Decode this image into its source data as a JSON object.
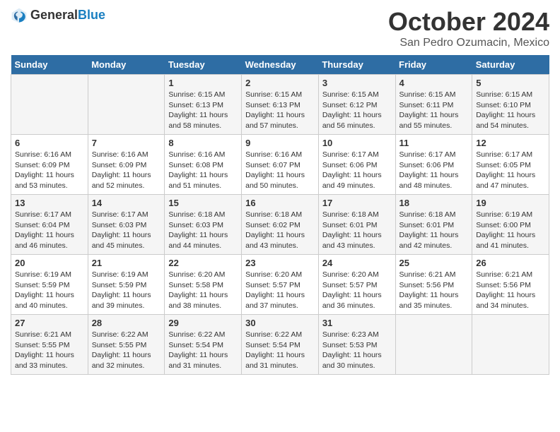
{
  "logo": {
    "general": "General",
    "blue": "Blue"
  },
  "title": "October 2024",
  "location": "San Pedro Ozumacin, Mexico",
  "days_header": [
    "Sunday",
    "Monday",
    "Tuesday",
    "Wednesday",
    "Thursday",
    "Friday",
    "Saturday"
  ],
  "weeks": [
    [
      {
        "day": "",
        "info": ""
      },
      {
        "day": "",
        "info": ""
      },
      {
        "day": "1",
        "info": "Sunrise: 6:15 AM\nSunset: 6:13 PM\nDaylight: 11 hours and 58 minutes."
      },
      {
        "day": "2",
        "info": "Sunrise: 6:15 AM\nSunset: 6:13 PM\nDaylight: 11 hours and 57 minutes."
      },
      {
        "day": "3",
        "info": "Sunrise: 6:15 AM\nSunset: 6:12 PM\nDaylight: 11 hours and 56 minutes."
      },
      {
        "day": "4",
        "info": "Sunrise: 6:15 AM\nSunset: 6:11 PM\nDaylight: 11 hours and 55 minutes."
      },
      {
        "day": "5",
        "info": "Sunrise: 6:15 AM\nSunset: 6:10 PM\nDaylight: 11 hours and 54 minutes."
      }
    ],
    [
      {
        "day": "6",
        "info": "Sunrise: 6:16 AM\nSunset: 6:09 PM\nDaylight: 11 hours and 53 minutes."
      },
      {
        "day": "7",
        "info": "Sunrise: 6:16 AM\nSunset: 6:09 PM\nDaylight: 11 hours and 52 minutes."
      },
      {
        "day": "8",
        "info": "Sunrise: 6:16 AM\nSunset: 6:08 PM\nDaylight: 11 hours and 51 minutes."
      },
      {
        "day": "9",
        "info": "Sunrise: 6:16 AM\nSunset: 6:07 PM\nDaylight: 11 hours and 50 minutes."
      },
      {
        "day": "10",
        "info": "Sunrise: 6:17 AM\nSunset: 6:06 PM\nDaylight: 11 hours and 49 minutes."
      },
      {
        "day": "11",
        "info": "Sunrise: 6:17 AM\nSunset: 6:06 PM\nDaylight: 11 hours and 48 minutes."
      },
      {
        "day": "12",
        "info": "Sunrise: 6:17 AM\nSunset: 6:05 PM\nDaylight: 11 hours and 47 minutes."
      }
    ],
    [
      {
        "day": "13",
        "info": "Sunrise: 6:17 AM\nSunset: 6:04 PM\nDaylight: 11 hours and 46 minutes."
      },
      {
        "day": "14",
        "info": "Sunrise: 6:17 AM\nSunset: 6:03 PM\nDaylight: 11 hours and 45 minutes."
      },
      {
        "day": "15",
        "info": "Sunrise: 6:18 AM\nSunset: 6:03 PM\nDaylight: 11 hours and 44 minutes."
      },
      {
        "day": "16",
        "info": "Sunrise: 6:18 AM\nSunset: 6:02 PM\nDaylight: 11 hours and 43 minutes."
      },
      {
        "day": "17",
        "info": "Sunrise: 6:18 AM\nSunset: 6:01 PM\nDaylight: 11 hours and 43 minutes."
      },
      {
        "day": "18",
        "info": "Sunrise: 6:18 AM\nSunset: 6:01 PM\nDaylight: 11 hours and 42 minutes."
      },
      {
        "day": "19",
        "info": "Sunrise: 6:19 AM\nSunset: 6:00 PM\nDaylight: 11 hours and 41 minutes."
      }
    ],
    [
      {
        "day": "20",
        "info": "Sunrise: 6:19 AM\nSunset: 5:59 PM\nDaylight: 11 hours and 40 minutes."
      },
      {
        "day": "21",
        "info": "Sunrise: 6:19 AM\nSunset: 5:59 PM\nDaylight: 11 hours and 39 minutes."
      },
      {
        "day": "22",
        "info": "Sunrise: 6:20 AM\nSunset: 5:58 PM\nDaylight: 11 hours and 38 minutes."
      },
      {
        "day": "23",
        "info": "Sunrise: 6:20 AM\nSunset: 5:57 PM\nDaylight: 11 hours and 37 minutes."
      },
      {
        "day": "24",
        "info": "Sunrise: 6:20 AM\nSunset: 5:57 PM\nDaylight: 11 hours and 36 minutes."
      },
      {
        "day": "25",
        "info": "Sunrise: 6:21 AM\nSunset: 5:56 PM\nDaylight: 11 hours and 35 minutes."
      },
      {
        "day": "26",
        "info": "Sunrise: 6:21 AM\nSunset: 5:56 PM\nDaylight: 11 hours and 34 minutes."
      }
    ],
    [
      {
        "day": "27",
        "info": "Sunrise: 6:21 AM\nSunset: 5:55 PM\nDaylight: 11 hours and 33 minutes."
      },
      {
        "day": "28",
        "info": "Sunrise: 6:22 AM\nSunset: 5:55 PM\nDaylight: 11 hours and 32 minutes."
      },
      {
        "day": "29",
        "info": "Sunrise: 6:22 AM\nSunset: 5:54 PM\nDaylight: 11 hours and 31 minutes."
      },
      {
        "day": "30",
        "info": "Sunrise: 6:22 AM\nSunset: 5:54 PM\nDaylight: 11 hours and 31 minutes."
      },
      {
        "day": "31",
        "info": "Sunrise: 6:23 AM\nSunset: 5:53 PM\nDaylight: 11 hours and 30 minutes."
      },
      {
        "day": "",
        "info": ""
      },
      {
        "day": "",
        "info": ""
      }
    ]
  ]
}
